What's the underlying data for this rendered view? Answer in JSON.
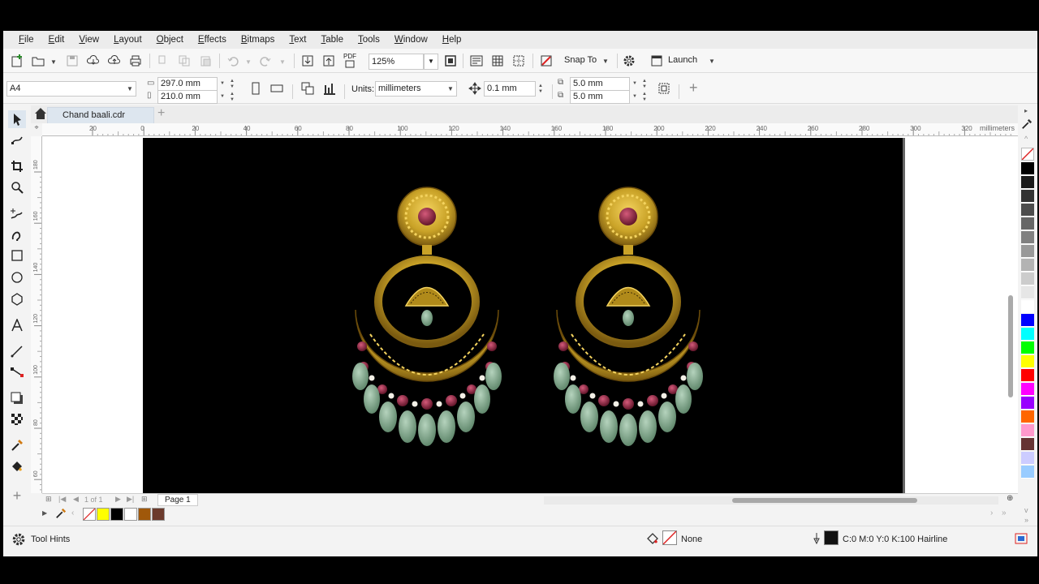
{
  "menu": [
    "File",
    "Edit",
    "View",
    "Layout",
    "Object",
    "Effects",
    "Bitmaps",
    "Text",
    "Table",
    "Tools",
    "Window",
    "Help"
  ],
  "menu_underline": [
    "F",
    "E",
    "V",
    "L",
    "O",
    "E",
    "B",
    "T",
    "T",
    "T",
    "W",
    "H"
  ],
  "toolbar": {
    "pdf_label": "PDF",
    "zoom_value": "125%",
    "snap_label": "Snap To",
    "launch_label": "Launch"
  },
  "propbar": {
    "page_size": "A4",
    "width": "297.0 mm",
    "height": "210.0 mm",
    "units_label": "Units:",
    "units_value": "millimeters",
    "nudge": "0.1 mm",
    "dup_x": "5.0 mm",
    "dup_y": "5.0 mm"
  },
  "document_tab": "Chand baali.cdr",
  "ruler": {
    "unit": "millimeters",
    "h_ticks": [
      "20",
      "0",
      "20",
      "40",
      "60",
      "80",
      "100",
      "120",
      "140",
      "160",
      "180",
      "200",
      "220",
      "240",
      "260",
      "280",
      "300",
      "320"
    ],
    "v_ticks": [
      "180",
      "160",
      "140",
      "120",
      "100",
      "80",
      "60"
    ]
  },
  "page_nav": {
    "page_counter": "1 of 1",
    "page_tab": "Page 1"
  },
  "status": {
    "tool_hints": "Tool Hints",
    "fill_label": "None",
    "outline_label": "C:0 M:0 Y:0 K:100  Hairline"
  },
  "document_palette": [
    "#ffffff",
    "#ffff00",
    "#000000",
    "#ffffff",
    "#a0580a",
    "#6b3a2c"
  ],
  "color_palette": [
    "#000000",
    "#1a1a1a",
    "#333333",
    "#4d4d4d",
    "#666666",
    "#808080",
    "#999999",
    "#b3b3b3",
    "#cccccc",
    "#e6e6e6",
    "#ffffff",
    "#0000ff",
    "#00ffff",
    "#00ff00",
    "#ffff00",
    "#ff0000",
    "#ff00ff",
    "#9900ff",
    "#ff6600",
    "#ff99cc",
    "#663333",
    "#ccccff",
    "#99ccff"
  ],
  "colors": {
    "gold": "#c9a227",
    "ruby": "#8a1f3a",
    "jade": "#7fa58b",
    "pearl": "#f2efe6"
  }
}
